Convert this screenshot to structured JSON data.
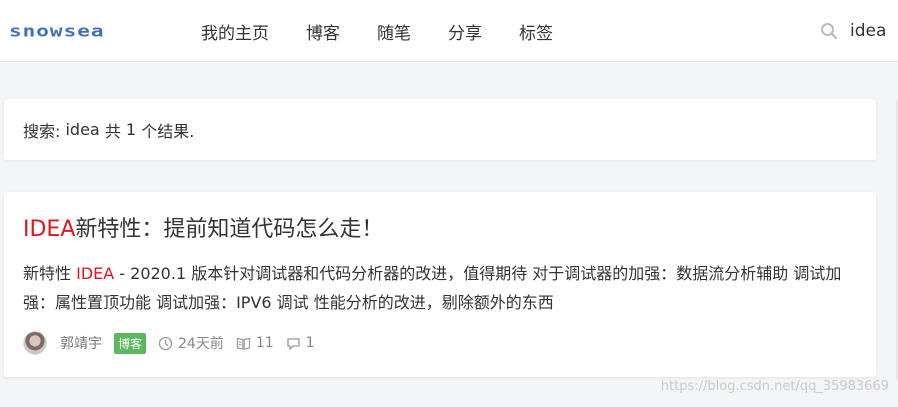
{
  "header": {
    "logo_text": "snowsea",
    "nav": [
      {
        "label": "我的主页"
      },
      {
        "label": "博客"
      },
      {
        "label": "随笔"
      },
      {
        "label": "分享"
      },
      {
        "label": "标签"
      }
    ],
    "search": {
      "value": "idea",
      "icon": "search-icon"
    }
  },
  "summary": {
    "prefix": "搜索: ",
    "query": "idea",
    "middle": " 共 ",
    "count": "1",
    "suffix": " 个结果."
  },
  "result": {
    "title_highlight": "IDEA",
    "title_rest": "新特性：提前知道代码怎么走！",
    "snippet_before": "新特性 ",
    "snippet_highlight": "IDEA",
    "snippet_after": " - 2020.1 版本针对调试器和代码分析器的改进，值得期待 对于调试器的加强：数据流分析辅助 调试加强：属性置顶功能 调试加强：IPV6 调试 性能分析的改进，剔除额外的东西",
    "author": "郭靖宇",
    "badge": "博客",
    "time": "24天前",
    "reads": "11",
    "comments": "1"
  },
  "watermark": "https://blog.csdn.net/qq_35983669",
  "colors": {
    "highlight": "#e4141b",
    "logo": "#3f6fbf",
    "badge": "#5cb85c"
  }
}
